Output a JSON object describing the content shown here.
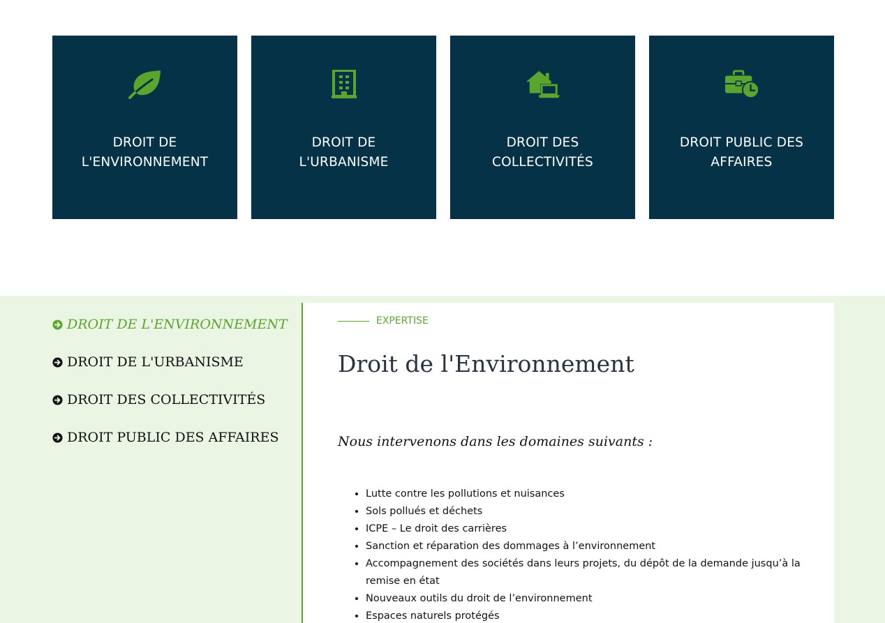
{
  "colors": {
    "card_background": "#053246",
    "accent_green": "#5aa62c",
    "section_background": "#eaf5e3",
    "heading_text": "#2a3340"
  },
  "cards": [
    {
      "icon": "leaf-icon",
      "title_line1": "DROIT DE",
      "title_line2": "L'ENVIRONNEMENT"
    },
    {
      "icon": "building-icon",
      "title_line1": "DROIT DE",
      "title_line2": "L'URBANISME"
    },
    {
      "icon": "house-laptop-icon",
      "title_line1": "DROIT DES",
      "title_line2": "COLLECTIVITÉS"
    },
    {
      "icon": "briefcase-clock-icon",
      "title_line1": "DROIT PUBLIC DES",
      "title_line2": "AFFAIRES"
    }
  ],
  "side_nav": {
    "items": [
      {
        "label": "DROIT DE L'ENVIRONNEMENT",
        "active": true
      },
      {
        "label": "DROIT DE L'URBANISME",
        "active": false
      },
      {
        "label": "DROIT DES COLLECTIVITÉS",
        "active": false
      },
      {
        "label": "DROIT PUBLIC DES AFFAIRES",
        "active": false
      }
    ]
  },
  "content": {
    "eyebrow": "EXPERTISE",
    "title": "Droit de l'Environnement",
    "intro": "Nous intervenons dans les domaines suivants :",
    "domains": [
      "Lutte contre les pollutions et nuisances",
      "Sols pollués et déchets",
      "ICPE – Le droit des carrières",
      "Sanction et réparation des dommages à l’environnement",
      "Accompagnement des sociétés dans leurs projets, du dépôt de la demande jusqu’à la remise en état",
      "Nouveaux outils du droit de l’environnement",
      "Espaces naturels protégés"
    ]
  }
}
